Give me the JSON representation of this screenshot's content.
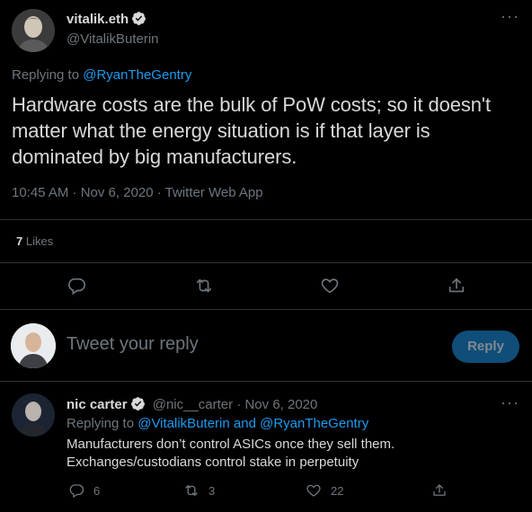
{
  "colors": {
    "background": "#000000",
    "text": "#d9d9d9",
    "muted": "#6e767d",
    "link": "#1d9bf0",
    "divider": "#2f3336",
    "reply_button_bg": "#0f4e78"
  },
  "tweet": {
    "display_name": "vitalik.eth",
    "handle": "@VitalikButerin",
    "more": "···",
    "replying_prefix": "Replying to ",
    "replying_to": "@RyanTheGentry",
    "text": "Hardware costs are the bulk of PoW costs; so it doesn't matter what the energy situation is if that layer is dominated by big manufacturers.",
    "timestamp": "10:45 AM · Nov 6, 2020 · Twitter Web App",
    "likes_count": "7",
    "likes_label": "Likes",
    "icons": [
      "reply-icon",
      "retweet-icon",
      "like-icon",
      "share-icon"
    ]
  },
  "composer": {
    "placeholder": "Tweet your reply",
    "button_label": "Reply"
  },
  "reply": {
    "display_name": "nic carter",
    "handle_time": "@nic__carter · Nov 6, 2020",
    "more": "···",
    "replying_prefix": "Replying to ",
    "replying_to_1": "@VitalikButerin",
    "replying_and": " and ",
    "replying_to_2": "@RyanTheGentry",
    "line1": "Manufacturers don’t control ASICs once they sell them.",
    "line2": "Exchanges/custodians control stake in perpetuity",
    "reply_count": "6",
    "retweet_count": "3",
    "like_count": "22"
  }
}
